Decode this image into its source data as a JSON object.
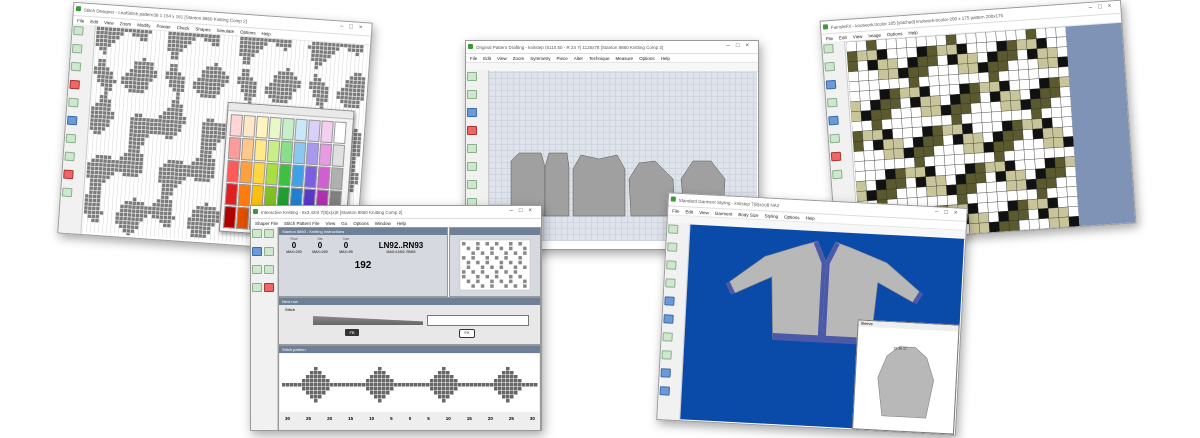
{
  "windows": {
    "stitch_designer": {
      "title": "Stitch Designer - LeafStitch.pattern38 1   154 x 161   [Stanton 8860 Knitting Comp 2]",
      "menu": [
        "File",
        "Edit",
        "View",
        "Zoom",
        "Modify",
        "Pointer",
        "Check",
        "Shapes",
        "Simulate",
        "Options",
        "Help"
      ]
    },
    "original_pattern": {
      "title": "Original Pattern Drafting - knitstep (5110.50 - R 24 7)   1125x78   [Stanton 8860 Knitting Comp 2]",
      "menu": [
        "File",
        "Edit",
        "View",
        "Zoom",
        "Symmetry",
        "Piece",
        "Alter",
        "Technique",
        "Measure",
        "Options",
        "Help"
      ]
    },
    "fairisle": {
      "title": "FairisleFX - knotwork.trcolor  105 [stitched] knotwork-trcolor-200 x 175 pattern 200x175",
      "menu": [
        "File",
        "Edit",
        "View",
        "Image",
        "Options",
        "Help"
      ]
    },
    "interactive": {
      "title": "Interactive Knitting - 8x3.42nt   7(8)x(x)8   [Stanton 8860 Knitting Comp 2]",
      "menu": [
        "Shaper File",
        "Stitch Pattern File",
        "View",
        "Go",
        "Options",
        "Window",
        "Help"
      ],
      "info_header": "Stanton 8860 - Knitting Instructions",
      "fields": [
        {
          "label": "Row",
          "value": "0",
          "sub": "MAX=200"
        },
        {
          "label": "Sts",
          "value": "0",
          "sub": "MAX=200"
        },
        {
          "label": "Carr",
          "value": "0",
          "sub": "MAX=99"
        }
      ],
      "needles": "LN92..RN93",
      "needles_sub": "MAX=LN92..RN93",
      "row_count": "192",
      "panel2_title": "Next row",
      "panel3_title": "Stitch pattern",
      "stitch_header": "Stitch",
      "left_btn": "FB",
      "right_btn": "FX",
      "needle_numbers": [
        "30",
        "25",
        "20",
        "15",
        "10",
        "5",
        "0",
        "5",
        "10",
        "15",
        "20",
        "25",
        "30"
      ]
    },
    "garment": {
      "title": "Standard Garment Styling - knitstep   7(8)x(x)8   NA2",
      "menu": [
        "File",
        "Edit",
        "View",
        "Garment",
        "Body Size",
        "Styling",
        "Options",
        "Help"
      ],
      "inset_title": "Sleeve",
      "inset_label": "15 16 17"
    }
  },
  "colors": {
    "palette": [
      "#ffd6d6",
      "#ffe8c8",
      "#fff5c0",
      "#e8f8c8",
      "#c8f0c8",
      "#c8e8f8",
      "#d8d0f8",
      "#f4d0f0",
      "#ffffff",
      "#ff9a9a",
      "#ffc88a",
      "#ffe98a",
      "#c8ee88",
      "#8ade8a",
      "#8ac8f0",
      "#a898ee",
      "#e89ae4",
      "#e0e0e0",
      "#ff5a5a",
      "#ffa040",
      "#ffd640",
      "#a8e040",
      "#40c040",
      "#40a0e8",
      "#7a60e0",
      "#d060d0",
      "#b0b0b0",
      "#e02020",
      "#ff7a10",
      "#f8c010",
      "#80c020",
      "#20a030",
      "#2080d0",
      "#5a38c8",
      "#b030b0",
      "#808080",
      "#b00000",
      "#e05000",
      "#e0a000",
      "#509010",
      "#108020",
      "#1060b0",
      "#3820a0",
      "#882088",
      "#404040"
    ],
    "knot_dark": "#5a5a2e",
    "knot_light": "#c9c59a",
    "garment_bg": "#0a4aa8",
    "jacket": "#b8b8b8",
    "trim": "#4a5aa8"
  }
}
